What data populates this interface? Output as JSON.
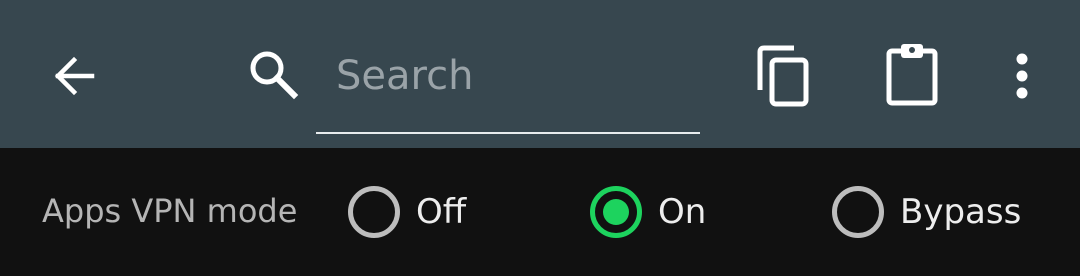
{
  "toolbar": {
    "background": "#37474F",
    "back_icon": "arrow-back-icon",
    "search": {
      "icon": "search-icon",
      "placeholder": "Search",
      "value": ""
    },
    "actions": [
      {
        "name": "copy",
        "icon": "copy-icon"
      },
      {
        "name": "paste",
        "icon": "clipboard-icon"
      },
      {
        "name": "more",
        "icon": "more-vertical-icon"
      }
    ]
  },
  "apps_vpn_mode": {
    "label": "Apps VPN mode",
    "accent_color": "#1DD35E",
    "options": [
      {
        "label": "Off",
        "selected": false
      },
      {
        "label": "On",
        "selected": true
      },
      {
        "label": "Bypass",
        "selected": false
      }
    ]
  }
}
